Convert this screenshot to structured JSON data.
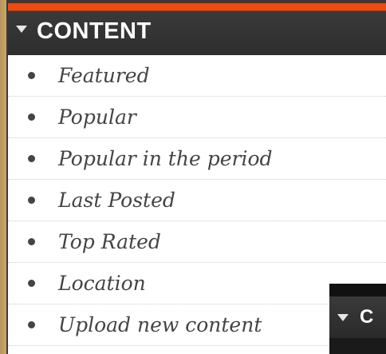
{
  "header": {
    "title": "CONTENT"
  },
  "menu": {
    "items": [
      {
        "label": "Featured"
      },
      {
        "label": "Popular"
      },
      {
        "label": "Popular in the period"
      },
      {
        "label": "Last Posted"
      },
      {
        "label": "Top Rated"
      },
      {
        "label": "Location"
      },
      {
        "label": "Upload new content"
      }
    ]
  },
  "secondary_widget": {
    "title_fragment": "C"
  },
  "colors": {
    "accent": "#f04a0f",
    "header_bg": "#2d2d2d",
    "text": "#444444"
  },
  "icons": {
    "header_toggle": "caret-down-icon",
    "list_marker": "bullet-icon"
  }
}
